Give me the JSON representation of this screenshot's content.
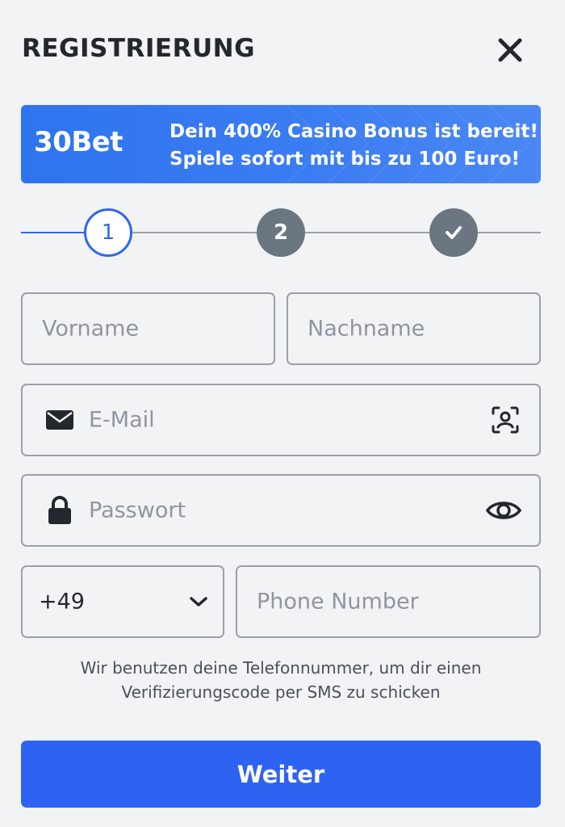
{
  "header": {
    "title": "REGISTRIERUNG",
    "close_icon": "close-icon"
  },
  "banner": {
    "logo": "30Bet",
    "line1": "Dein 400% Casino Bonus ist bereit!",
    "line2": "Spiele sofort mit bis zu 100 Euro!",
    "background_color": "#3478f0"
  },
  "stepper": {
    "steps": [
      {
        "label": "1",
        "state": "active"
      },
      {
        "label": "2",
        "state": "upcoming"
      },
      {
        "label": "check-icon",
        "state": "upcoming"
      }
    ],
    "active_color": "#2e66f0",
    "inactive_color": "#6c7680"
  },
  "form": {
    "first_name_placeholder": "Vorname",
    "last_name_placeholder": "Nachname",
    "email_placeholder": "E-Mail",
    "email_left_icon": "mail-icon",
    "email_right_icon": "contact-scan-icon",
    "password_placeholder": "Passwort",
    "password_left_icon": "lock-icon",
    "password_right_icon": "eye-icon",
    "country_code": "+49",
    "country_dropdown_icon": "chevron-down-icon",
    "phone_placeholder": "Phone Number"
  },
  "hint": {
    "line1": "Wir benutzen deine Telefonnummer, um dir einen",
    "line2": "Verifizierungscode per SMS zu schicken"
  },
  "submit": {
    "label": "Weiter",
    "color": "#2d63f0"
  }
}
